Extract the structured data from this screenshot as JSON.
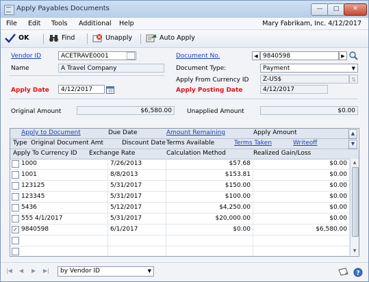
{
  "window": {
    "title": "Apply Payables Documents",
    "minimize": "—",
    "maximize": "□",
    "close": "✕"
  },
  "menu": {
    "items": [
      "File",
      "Edit",
      "Tools",
      "Additional",
      "Help"
    ],
    "company": "Mary  Fabrikam, Inc.  4/12/2017"
  },
  "toolbar": {
    "ok": "OK",
    "find": "Find",
    "unapply": "Unapply",
    "auto_apply": "Auto Apply"
  },
  "header": {
    "vendor_id_label": "Vendor ID",
    "vendor_id_value": "ACETRAVE0001",
    "name_label": "Name",
    "name_value": "A Travel Company",
    "apply_date_label": "Apply Date",
    "apply_date_value": "4/12/2017",
    "document_no_label": "Document No.",
    "document_no_value": "9840598",
    "document_type_label": "Document Type:",
    "document_type_value": "Payment",
    "currency_id_label": "Apply From Currency ID",
    "currency_id_value": "Z-US$",
    "posting_date_label": "Apply Posting Date",
    "posting_date_value": "4/12/2017",
    "original_amount_label": "Original Amount",
    "original_amount_value": "$6,580.00",
    "unapplied_amount_label": "Unapplied Amount",
    "unapplied_amount_value": "$0.00"
  },
  "grid": {
    "header1": [
      "Apply to Document",
      "Due Date",
      "Amount Remaining",
      "Apply Amount"
    ],
    "header2": [
      "Type",
      "Original Document Amt",
      "Discount Date",
      "Terms Available",
      "Terms Taken",
      "Writeoff"
    ],
    "header3": [
      "Apply To Currency ID",
      "Exchange Rate",
      "Calculation Method",
      "Realized Gain/Loss"
    ],
    "rows": [
      {
        "checked": false,
        "document": "1000",
        "due_date": "7/26/2013",
        "amount_remaining": "$57.68",
        "apply_amount": "$0.00"
      },
      {
        "checked": false,
        "document": "1001",
        "due_date": "8/8/2013",
        "amount_remaining": "$153.81",
        "apply_amount": "$0.00"
      },
      {
        "checked": false,
        "document": "123125",
        "due_date": "5/31/2017",
        "amount_remaining": "$150.00",
        "apply_amount": "$0.00"
      },
      {
        "checked": false,
        "document": "123345",
        "due_date": "5/31/2017",
        "amount_remaining": "$100.00",
        "apply_amount": "$0.00"
      },
      {
        "checked": false,
        "document": "5436",
        "due_date": "5/12/2017",
        "amount_remaining": "$4,250.00",
        "apply_amount": "$0.00"
      },
      {
        "checked": false,
        "document": "555 4/1/2017",
        "due_date": "5/31/2017",
        "amount_remaining": "$20,000.00",
        "apply_amount": "$0.00"
      },
      {
        "checked": true,
        "document": "9840598",
        "due_date": "6/1/2017",
        "amount_remaining": "$0.00",
        "apply_amount": "$6,580.00"
      },
      {
        "checked": false,
        "document": "",
        "due_date": "",
        "amount_remaining": "",
        "apply_amount": ""
      },
      {
        "checked": false,
        "document": "",
        "due_date": "",
        "amount_remaining": "",
        "apply_amount": ""
      }
    ]
  },
  "bottom": {
    "sort_by": "by Vendor ID"
  },
  "colors": {
    "link": "#1a3fb8",
    "required": "#e01010",
    "title_bar": "#c4d6ee",
    "close_button": "#c24a34"
  }
}
